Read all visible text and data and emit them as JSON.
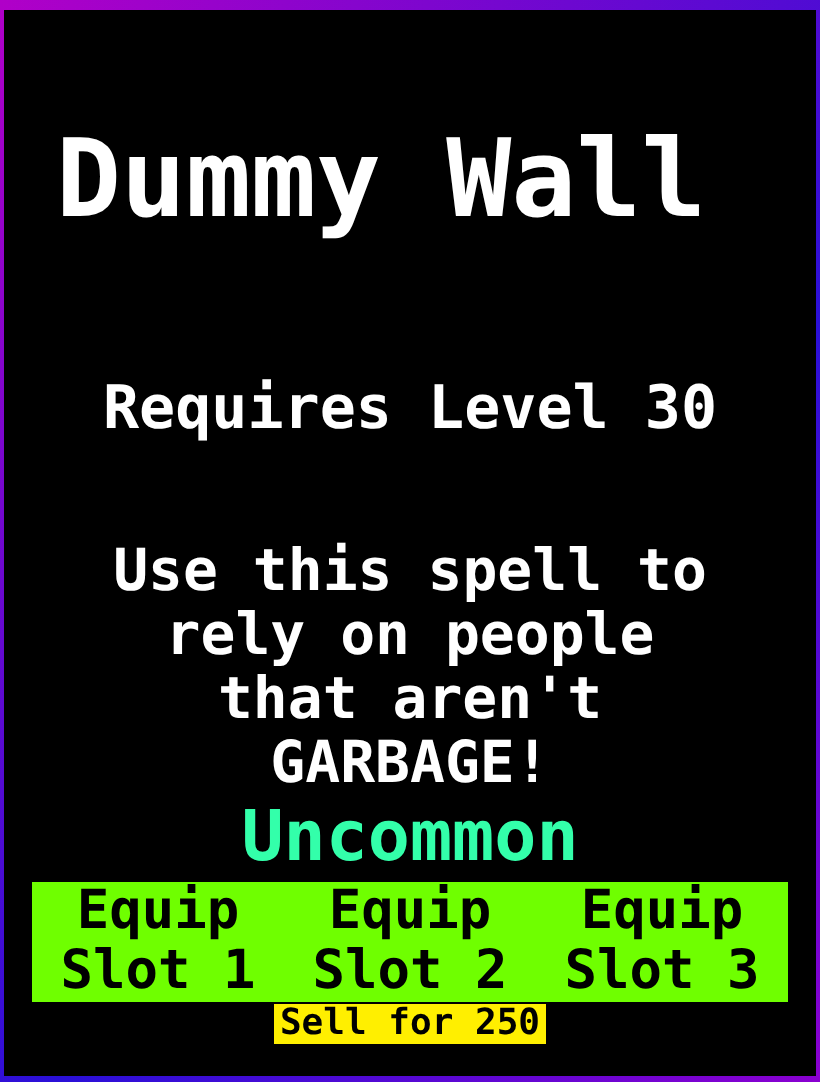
{
  "title": "Dummy Wall",
  "requirement": "Requires Level 30",
  "description": "Use this spell to rely on people that aren't GARBAGE!",
  "rarity": {
    "label": "Uncommon",
    "color": "#33ffaa"
  },
  "equip_buttons": [
    {
      "label": "Equip Slot 1"
    },
    {
      "label": "Equip Slot 2"
    },
    {
      "label": "Equip Slot 3"
    }
  ],
  "sell_button": "Sell for 250"
}
